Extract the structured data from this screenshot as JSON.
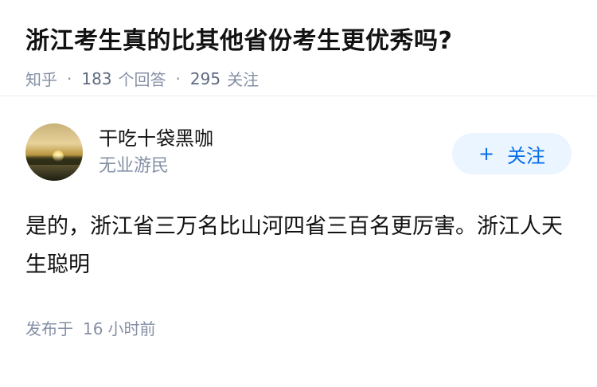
{
  "question": {
    "title": "浙江考生真的比其他省份考生更优秀吗?",
    "source": "知乎",
    "answer_count": "183",
    "answer_label": "个回答",
    "follow_count": "295",
    "follow_label": "关注"
  },
  "answer": {
    "author_name": "干吃十袋黑咖",
    "author_bio": "无业游民",
    "follow_button": "关注",
    "follow_icon": "+",
    "content": "是的，浙江省三万名比山河四省三百名更厉害。浙江人天生聪明",
    "posted_label": "发布于",
    "posted_value": "16",
    "posted_unit": "小时前"
  },
  "colors": {
    "accent": "#056de8",
    "button_bg": "#ebf5ff",
    "muted": "#8590a6"
  }
}
